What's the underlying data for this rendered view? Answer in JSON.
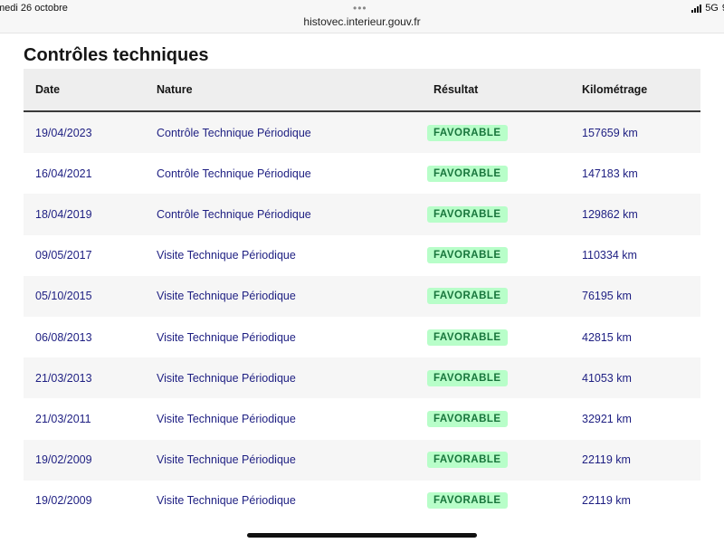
{
  "status_bar": {
    "date": "medi 26 octobre",
    "dots": "•••",
    "url": "histovec.interieur.gouv.fr",
    "network": "5G",
    "battery_fragment": "9"
  },
  "page": {
    "title": "Contrôles techniques"
  },
  "table": {
    "headers": {
      "date": "Date",
      "nature": "Nature",
      "result": "Résultat",
      "mileage": "Kilométrage"
    },
    "rows": [
      {
        "date": "19/04/2023",
        "nature": "Contrôle Technique Périodique",
        "result": "FAVORABLE",
        "mileage": "157659 km"
      },
      {
        "date": "16/04/2021",
        "nature": "Contrôle Technique Périodique",
        "result": "FAVORABLE",
        "mileage": "147183 km"
      },
      {
        "date": "18/04/2019",
        "nature": "Contrôle Technique Périodique",
        "result": "FAVORABLE",
        "mileage": "129862 km"
      },
      {
        "date": "09/05/2017",
        "nature": "Visite Technique Périodique",
        "result": "FAVORABLE",
        "mileage": "110334 km"
      },
      {
        "date": "05/10/2015",
        "nature": "Visite Technique Périodique",
        "result": "FAVORABLE",
        "mileage": "76195 km"
      },
      {
        "date": "06/08/2013",
        "nature": "Visite Technique Périodique",
        "result": "FAVORABLE",
        "mileage": "42815 km"
      },
      {
        "date": "21/03/2013",
        "nature": "Visite Technique Périodique",
        "result": "FAVORABLE",
        "mileage": "41053 km"
      },
      {
        "date": "21/03/2011",
        "nature": "Visite Technique Périodique",
        "result": "FAVORABLE",
        "mileage": "32921 km"
      },
      {
        "date": "19/02/2009",
        "nature": "Visite Technique Périodique",
        "result": "FAVORABLE",
        "mileage": "22119 km"
      },
      {
        "date": "19/02/2009",
        "nature": "Visite Technique Périodique",
        "result": "FAVORABLE",
        "mileage": "22119 km"
      }
    ]
  },
  "colors": {
    "link_text": "#1e1f82",
    "badge_bg": "#b8fec9",
    "badge_text": "#18753c",
    "header_bg": "#eeeeee"
  },
  "icons": {
    "signal": "cellular-signal-icon"
  }
}
